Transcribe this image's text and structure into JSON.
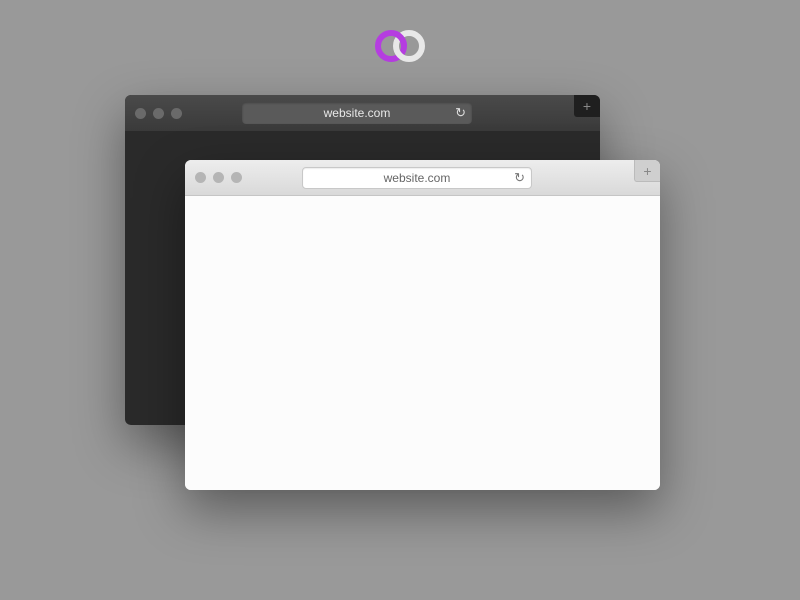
{
  "logo": {
    "left_color": "#b53de0",
    "right_color": "#e8e8e8"
  },
  "dark_window": {
    "url": "website.com"
  },
  "light_window": {
    "url": "website.com"
  }
}
